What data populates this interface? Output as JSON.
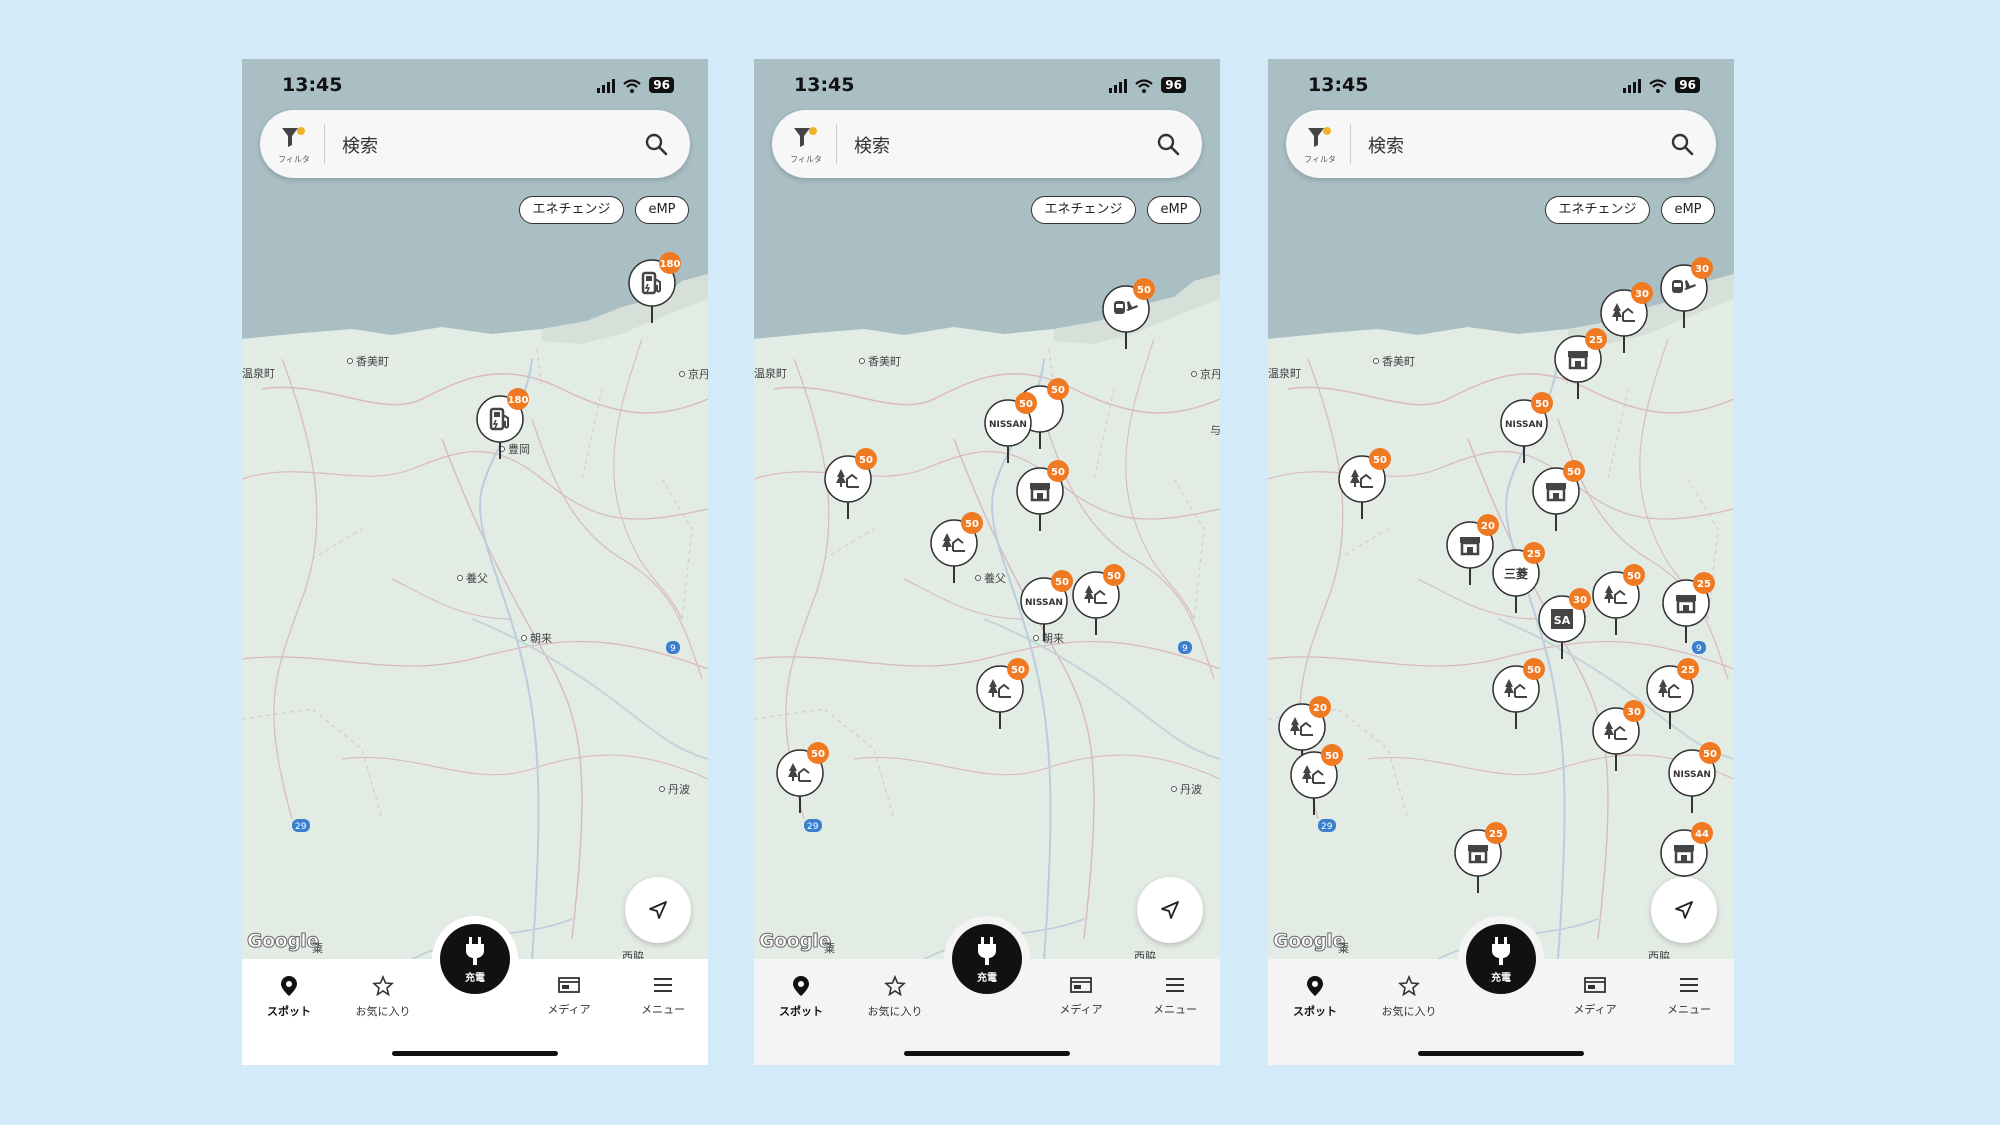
{
  "status": {
    "time": "13:45",
    "battery": "96"
  },
  "search": {
    "filter_label": "フィルタ",
    "placeholder": "検索"
  },
  "chips": [
    "エネチェンジ",
    "eMP"
  ],
  "map_places": {
    "kasumi": "香美町",
    "onsen": "温泉町",
    "kyotango": "京丹",
    "toyooka": "豊岡",
    "yabu": "養父",
    "asago": "朝来",
    "tamba": "丹波",
    "nishiwaki": "西脇",
    "awa": "粟",
    "yosa": "与",
    "route9": "9",
    "route29": "29",
    "google": "Google"
  },
  "markers": {
    "p1": [
      {
        "icon": "fuel-station-icon",
        "badge": "180"
      },
      {
        "icon": "fuel-station-icon",
        "badge": "180"
      }
    ],
    "p2": [
      {
        "icon": "transit-icon",
        "badge": "50"
      },
      {
        "icon": "nissan-logo",
        "text": "NISSAN",
        "badge": "50"
      },
      {
        "icon": "park-icon",
        "badge": "50"
      },
      {
        "icon": "store-icon",
        "badge": "50"
      },
      {
        "icon": "park-icon",
        "badge": "50"
      },
      {
        "icon": "nissan-logo",
        "text": "NISSAN",
        "badge": "50"
      },
      {
        "icon": "park-icon",
        "badge": "50"
      },
      {
        "icon": "park-icon",
        "badge": "50"
      },
      {
        "icon": "park-icon",
        "badge": "50"
      }
    ],
    "p3": [
      {
        "icon": "transit-icon",
        "badge": "30"
      },
      {
        "icon": "store-icon",
        "badge": "25"
      },
      {
        "icon": "park-icon",
        "badge": "30"
      },
      {
        "icon": "nissan-logo",
        "text": "NISSAN",
        "badge": "50"
      },
      {
        "icon": "store-icon",
        "badge": "50"
      },
      {
        "icon": "park-icon",
        "badge": "50"
      },
      {
        "icon": "store-icon",
        "badge": "20"
      },
      {
        "icon": "dealer-logo",
        "text": "三菱",
        "badge": "25"
      },
      {
        "icon": "sa-icon",
        "text": "SA",
        "badge": "30"
      },
      {
        "icon": "park-icon",
        "badge": "50"
      },
      {
        "icon": "store-icon",
        "badge": "25"
      },
      {
        "icon": "park-icon",
        "badge": "50"
      },
      {
        "icon": "park-icon",
        "badge": "25"
      },
      {
        "icon": "park-icon",
        "badge": "20"
      },
      {
        "icon": "park-icon",
        "badge": "50"
      },
      {
        "icon": "park-icon",
        "badge": "30"
      },
      {
        "icon": "nissan-logo",
        "text": "NISSAN",
        "badge": "50"
      },
      {
        "icon": "store-icon",
        "badge": "44"
      },
      {
        "icon": "store-icon",
        "badge": "25"
      }
    ]
  },
  "tabs": {
    "spot": "スポット",
    "favorites": "お気に入り",
    "charge": "充電",
    "media": "メディア",
    "menu": "メニュー"
  }
}
